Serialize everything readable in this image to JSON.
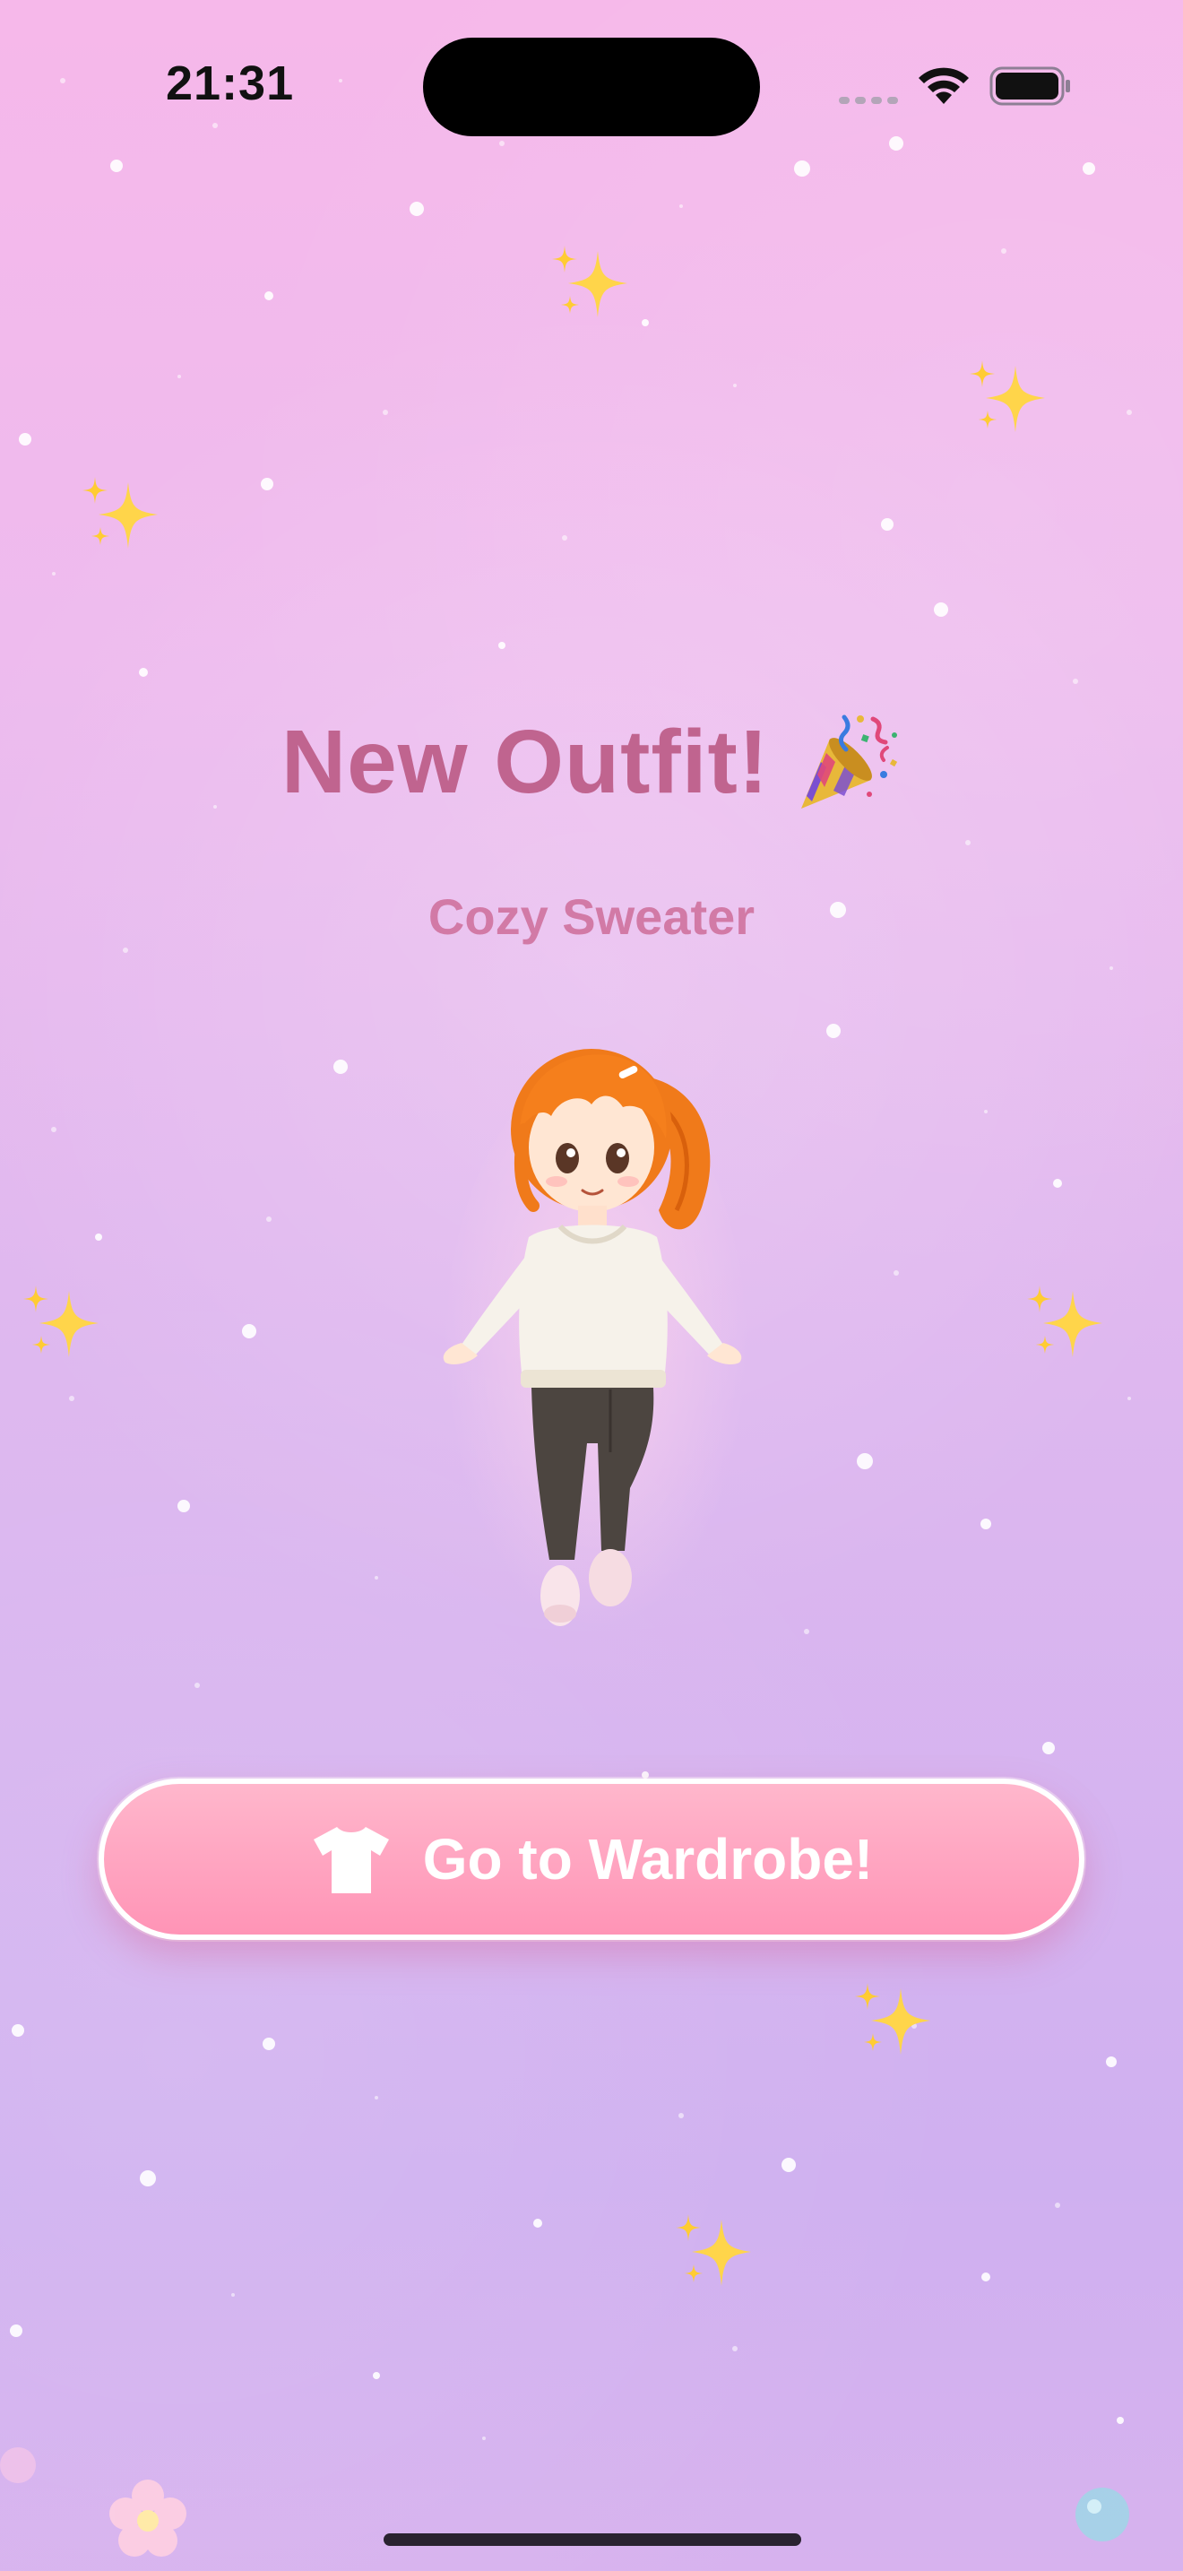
{
  "status_bar": {
    "time": "21:31"
  },
  "main": {
    "title": "New Outfit!",
    "title_icon": "party-popper-icon",
    "subtitle": "Cozy Sweater",
    "character": "avatar-girl-in-cozy-sweater"
  },
  "wardrobe_button": {
    "label": "Go to Wardrobe!",
    "icon": "tshirt-icon"
  },
  "colors": {
    "title": "#c0648f",
    "subtitle": "#d27aa6",
    "button_top": "#ffb7cc",
    "button_bottom": "#ff94b6",
    "background_top": "#f6b8ea",
    "background_bottom": "#cfb0f0"
  }
}
